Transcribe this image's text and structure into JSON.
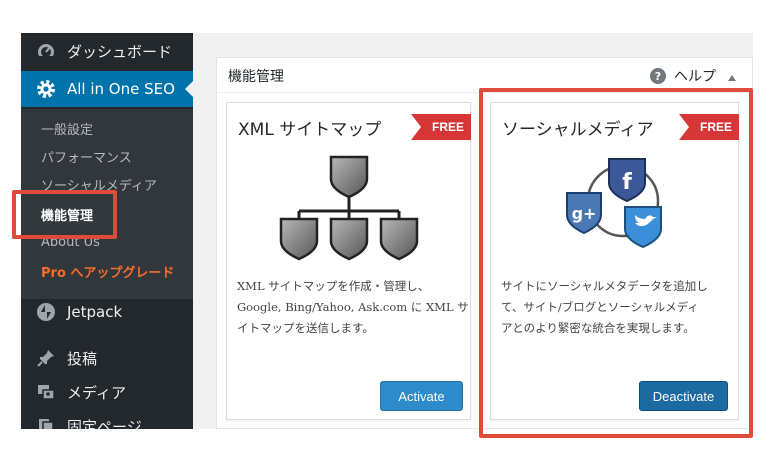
{
  "sidebar": {
    "dashboard": "ダッシュボード",
    "aioseo": "All in One SEO",
    "submenu": [
      "一般設定",
      "パフォーマンス",
      "ソーシャルメディア",
      "機能管理",
      "About Us",
      "Pro へアップグレード"
    ],
    "jetpack": "Jetpack",
    "posts": "投稿",
    "media": "メディア",
    "pages": "固定ページ"
  },
  "panel": {
    "title": "機能管理",
    "help": "ヘルプ"
  },
  "cards": [
    {
      "title": "XML サイトマップ",
      "badge": "FREE",
      "description": [
        "XML サイトマップを作成・管理し、",
        "Google, Bing/Yahoo, Ask.com に XML サ",
        "イトマップを送信します。"
      ],
      "button": "Activate"
    },
    {
      "title": "ソーシャルメディア",
      "badge": "FREE",
      "description": [
        "サイトにソーシャルメタデータを追加し",
        "て、サイト/ブログとソーシャルメディ",
        "アとのより緊密な統合を実現します。"
      ],
      "button": "Deactivate"
    }
  ],
  "colors": {
    "sidebar_bg": "#23282d",
    "active_menu": "#0073aa",
    "highlight": "#e04a3a",
    "ribbon": "#d63638"
  }
}
